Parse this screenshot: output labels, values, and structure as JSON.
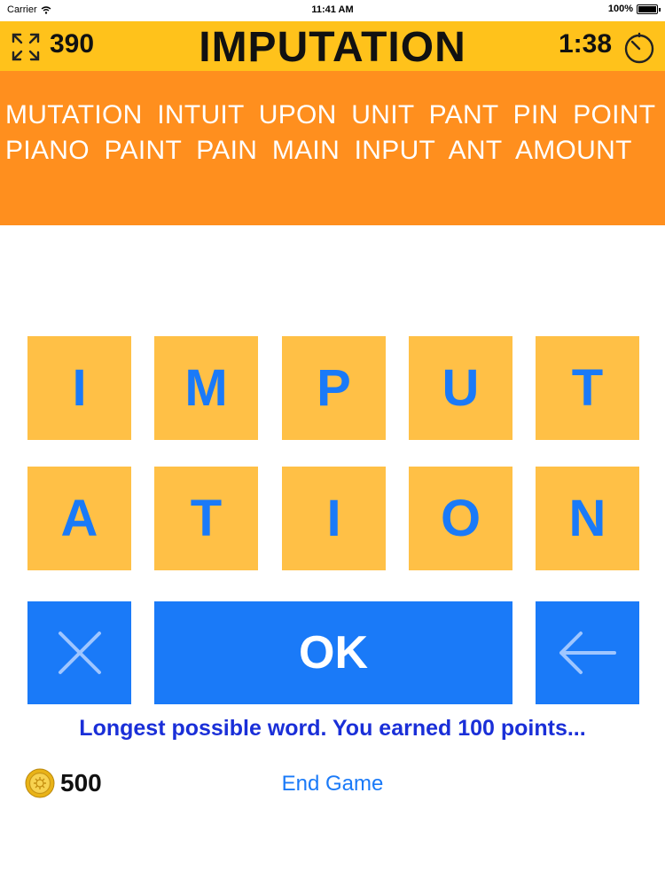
{
  "status_bar": {
    "carrier": "Carrier",
    "time": "11:41 AM",
    "battery": "100%"
  },
  "header": {
    "score": "390",
    "word": "IMPUTATION",
    "timer": "1:38"
  },
  "found_words": "MUTATION INTUIT UPON UNIT PANT PIN POINT PIANO PAINT PAIN MAIN INPUT ANT AMOUNT",
  "tiles": [
    {
      "letter": "I"
    },
    {
      "letter": "M"
    },
    {
      "letter": "P"
    },
    {
      "letter": "U"
    },
    {
      "letter": "T"
    },
    {
      "letter": "A"
    },
    {
      "letter": "T"
    },
    {
      "letter": "I"
    },
    {
      "letter": "O"
    },
    {
      "letter": "N"
    }
  ],
  "actions": {
    "ok_label": "OK"
  },
  "message": "Longest possible word. You earned 100 points...",
  "coins": "500",
  "end_game_label": "End Game",
  "colors": {
    "header": "#ffc21b",
    "found_words_bg": "#ff8f1e",
    "tile": "#ffc046",
    "accent_blue": "#1a7af8",
    "message": "#1a2fd8"
  }
}
